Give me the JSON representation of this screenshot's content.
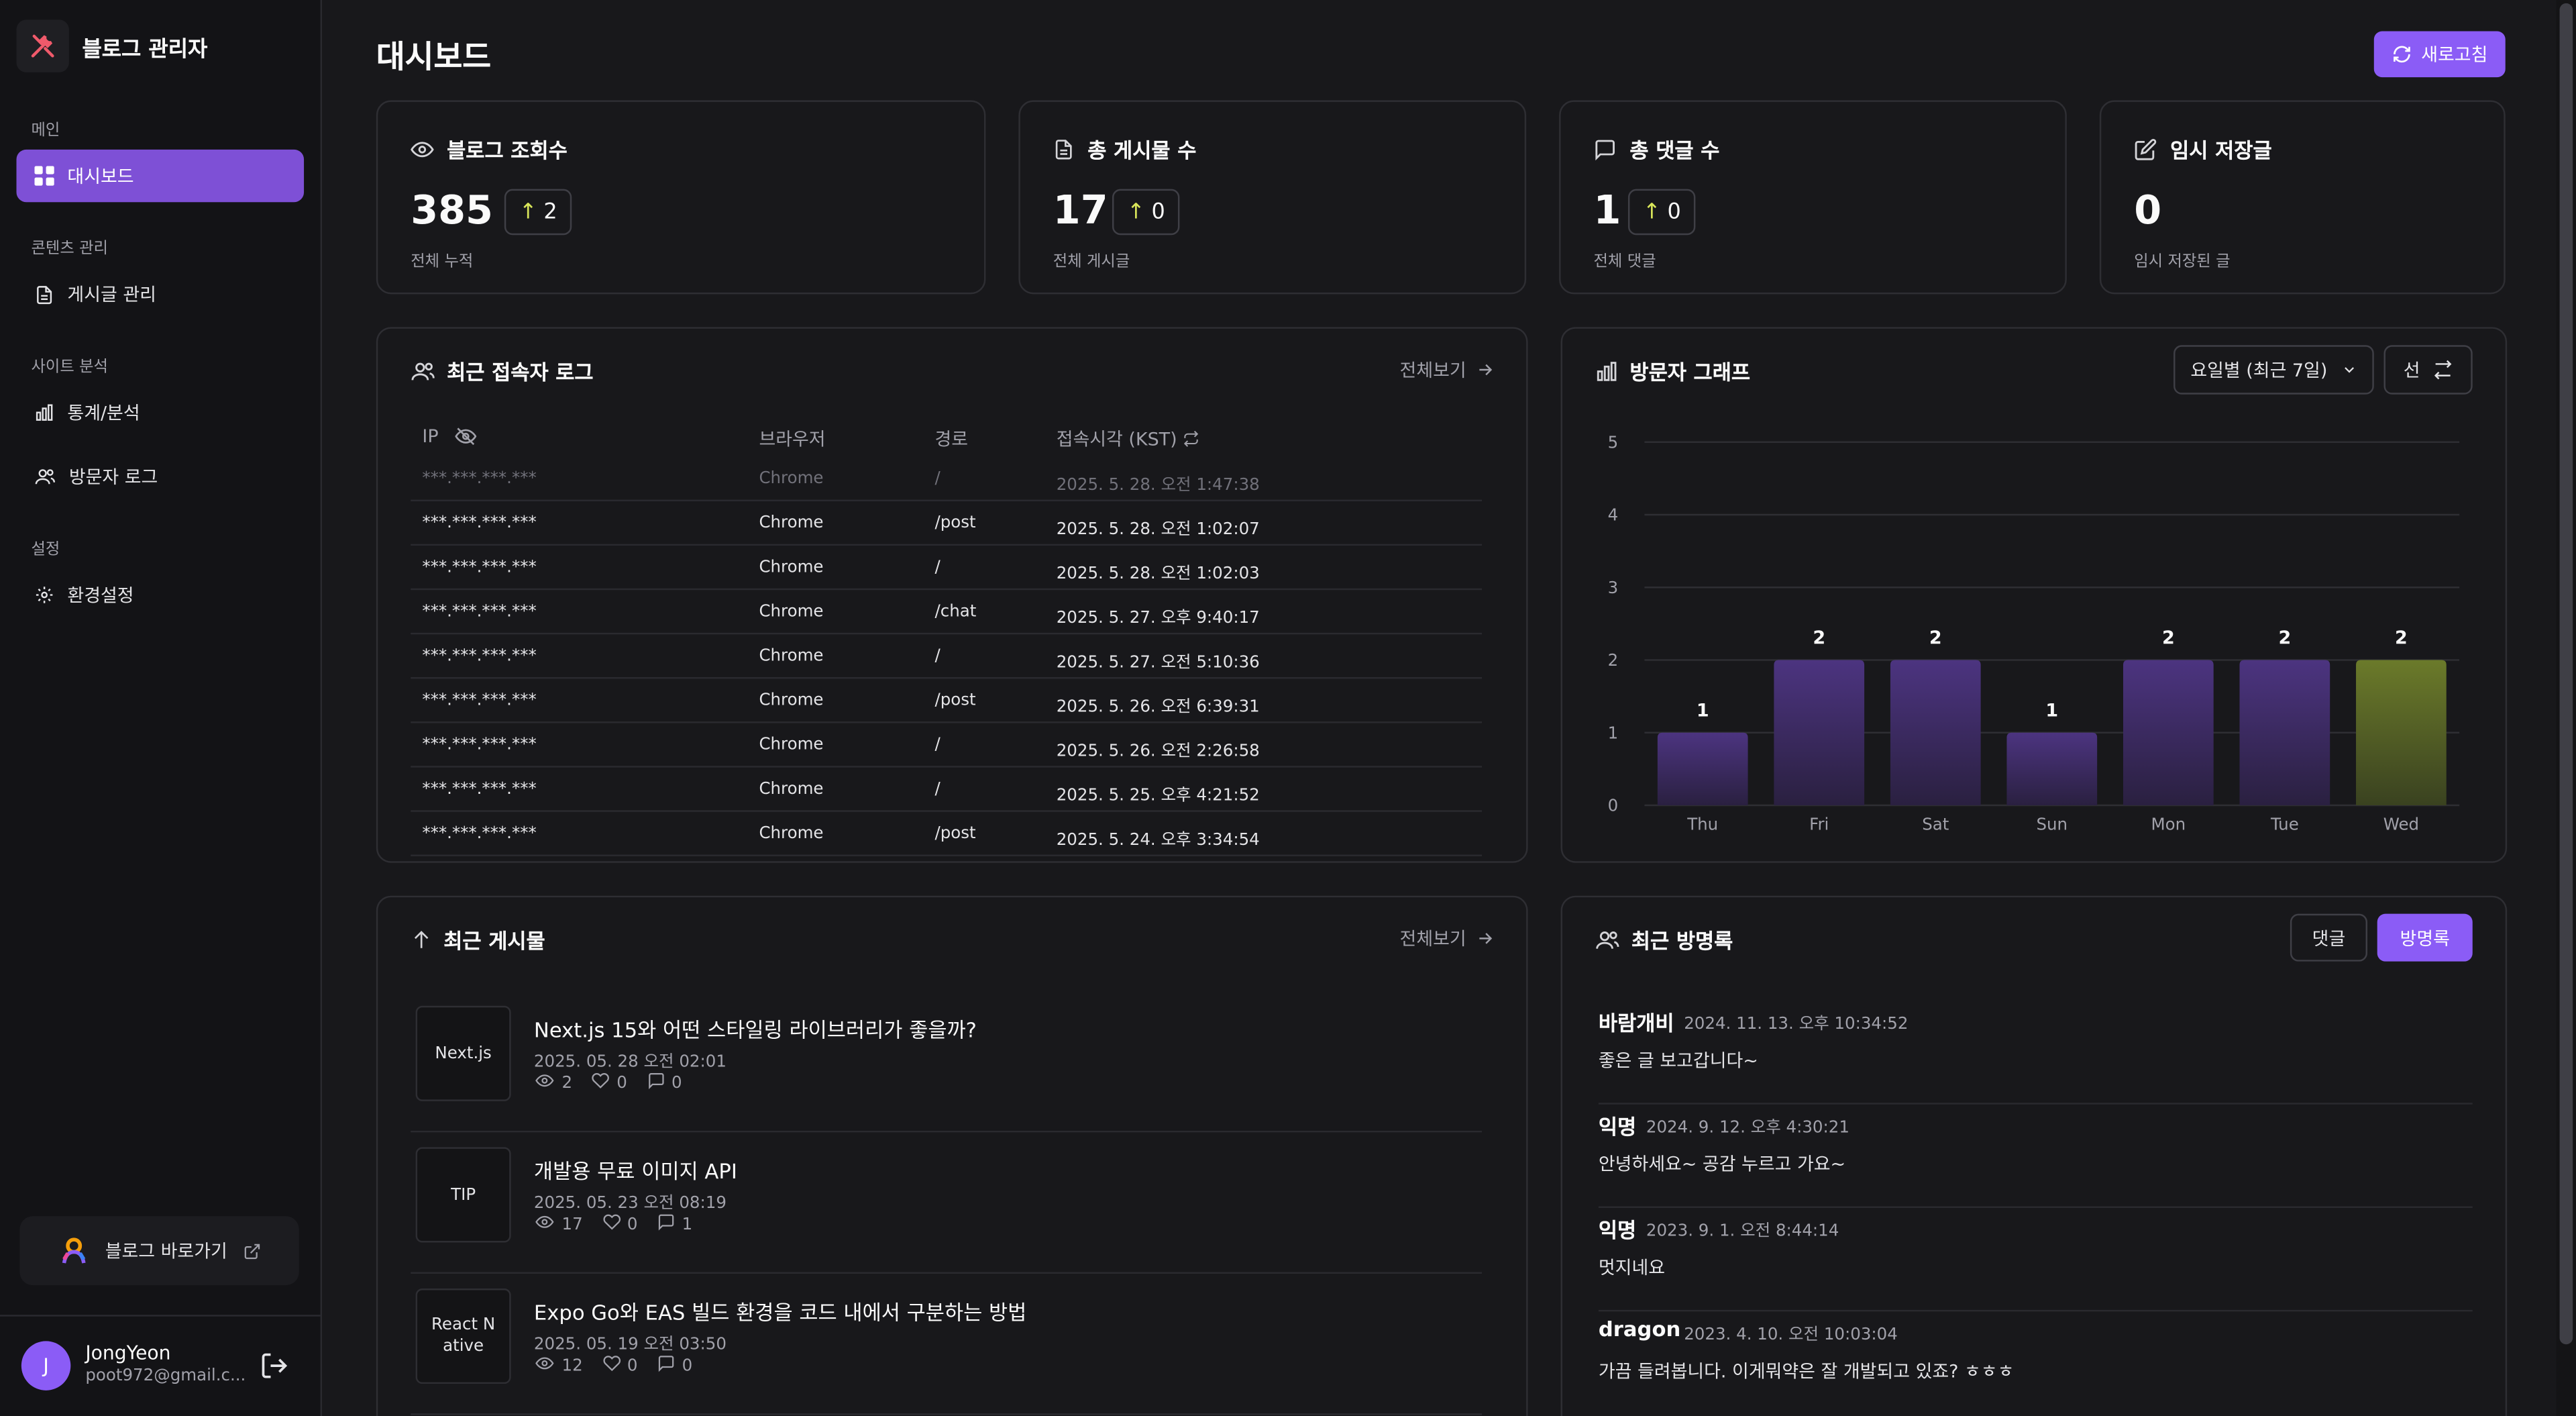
{
  "sidebar": {
    "title": "블로그 관리자",
    "sections": [
      {
        "label": "메인"
      },
      {
        "label": "콘텐츠 관리"
      },
      {
        "label": "사이트 분석"
      },
      {
        "label": "설정"
      }
    ],
    "items": [
      {
        "label": "대시보드",
        "icon": "grid-icon",
        "active": true
      },
      {
        "label": "게시글 관리",
        "icon": "file-icon"
      },
      {
        "label": "통계/분석",
        "icon": "bar-chart-icon"
      },
      {
        "label": "방문자 로그",
        "icon": "users-icon"
      },
      {
        "label": "환경설정",
        "icon": "gear-icon"
      }
    ],
    "go_blog": "블로그 바로가기",
    "user": {
      "initial": "J",
      "name": "JongYeon",
      "email": "poot972@gmail.c..."
    }
  },
  "header": {
    "title": "대시보드",
    "refresh": "새로고침"
  },
  "stats": [
    {
      "label": "블로그 조회수",
      "value": "385",
      "delta": "2",
      "sub": "전체 누적"
    },
    {
      "label": "총 게시물 수",
      "value": "17",
      "delta": "0",
      "sub": "전체 게시글"
    },
    {
      "label": "총 댓글 수",
      "value": "1",
      "delta": "0",
      "sub": "전체 댓글"
    },
    {
      "label": "임시 저장글",
      "value": "0",
      "sub": "임시 저장된 글"
    }
  ],
  "access_log": {
    "title": "최근 접속자 로그",
    "view_all": "전체보기",
    "columns": [
      "IP",
      "브라우저",
      "경로",
      "접속시각 (KST)"
    ],
    "rows": [
      {
        "ip": "***.***.***.***",
        "browser": "Chrome",
        "path": "/",
        "time": "2025. 5. 28. 오전 1:47:38"
      },
      {
        "ip": "***.***.***.***",
        "browser": "Chrome",
        "path": "/post",
        "time": "2025. 5. 28. 오전 1:02:07"
      },
      {
        "ip": "***.***.***.***",
        "browser": "Chrome",
        "path": "/",
        "time": "2025. 5. 28. 오전 1:02:03"
      },
      {
        "ip": "***.***.***.***",
        "browser": "Chrome",
        "path": "/chat",
        "time": "2025. 5. 27. 오후 9:40:17"
      },
      {
        "ip": "***.***.***.***",
        "browser": "Chrome",
        "path": "/",
        "time": "2025. 5. 27. 오전 5:10:36"
      },
      {
        "ip": "***.***.***.***",
        "browser": "Chrome",
        "path": "/post",
        "time": "2025. 5. 26. 오전 6:39:31"
      },
      {
        "ip": "***.***.***.***",
        "browser": "Chrome",
        "path": "/",
        "time": "2025. 5. 26. 오전 2:26:58"
      },
      {
        "ip": "***.***.***.***",
        "browser": "Chrome",
        "path": "/",
        "time": "2025. 5. 25. 오후 4:21:52"
      },
      {
        "ip": "***.***.***.***",
        "browser": "Chrome",
        "path": "/post",
        "time": "2025. 5. 24. 오후 3:34:54"
      }
    ]
  },
  "visitor_graph": {
    "title": "방문자 그래프",
    "range_select": "요일별 (최근 7일)",
    "chart_type_button": "선"
  },
  "chart_data": {
    "type": "bar",
    "categories": [
      "Thu",
      "Fri",
      "Sat",
      "Sun",
      "Mon",
      "Tue",
      "Wed"
    ],
    "values": [
      1,
      2,
      2,
      1,
      2,
      2,
      2
    ],
    "ylim": [
      0,
      5
    ],
    "yticks": [
      0,
      1,
      2,
      3,
      4,
      5
    ],
    "highlight_index": 6,
    "bar_color": "#4c3480",
    "highlight_color": "#6b7a2a",
    "grid": true
  },
  "recent_posts": {
    "title": "최근 게시물",
    "view_all": "전체보기",
    "items": [
      {
        "thumb": "Next.js",
        "title": "Next.js 15와 어떤 스타일링 라이브러리가 좋을까?",
        "date": "2025. 05. 28 오전 02:01",
        "views": "2",
        "likes": "0",
        "comments": "0"
      },
      {
        "thumb": "TIP",
        "title": "개발용 무료 이미지 API",
        "date": "2025. 05. 23 오전 08:19",
        "views": "17",
        "likes": "0",
        "comments": "1"
      },
      {
        "thumb": "React Native",
        "title": "Expo Go와 EAS 빌드 환경을 코드 내에서 구분하는 방법",
        "date": "2025. 05. 19 오전 03:50",
        "views": "12",
        "likes": "0",
        "comments": "0"
      }
    ]
  },
  "guestbook": {
    "title": "최근 방명록",
    "tab_comments": "댓글",
    "tab_guestbook": "방명록",
    "entries": [
      {
        "name": "바람개비",
        "date": "2024. 11. 13. 오후 10:34:52",
        "message": "좋은 글 보고갑니다~"
      },
      {
        "name": "익명",
        "date": "2024. 9. 12. 오후 4:30:21",
        "message": "안녕하세요~ 공감 누르고 가요~"
      },
      {
        "name": "익명",
        "date": "2023. 9. 1. 오전 8:44:14",
        "message": "멋지네요"
      },
      {
        "name": "dragon",
        "date": "2023. 4. 10. 오전 10:03:04",
        "message": "가끔 들려봅니다. 이게뭐약은 잘 개발되고 있죠? ㅎㅎㅎ"
      }
    ]
  },
  "colors": {
    "accent": "#8b5cf6",
    "background": "#18181b",
    "sidebar": "#131316",
    "delta_arrow": "#d9e65a"
  }
}
